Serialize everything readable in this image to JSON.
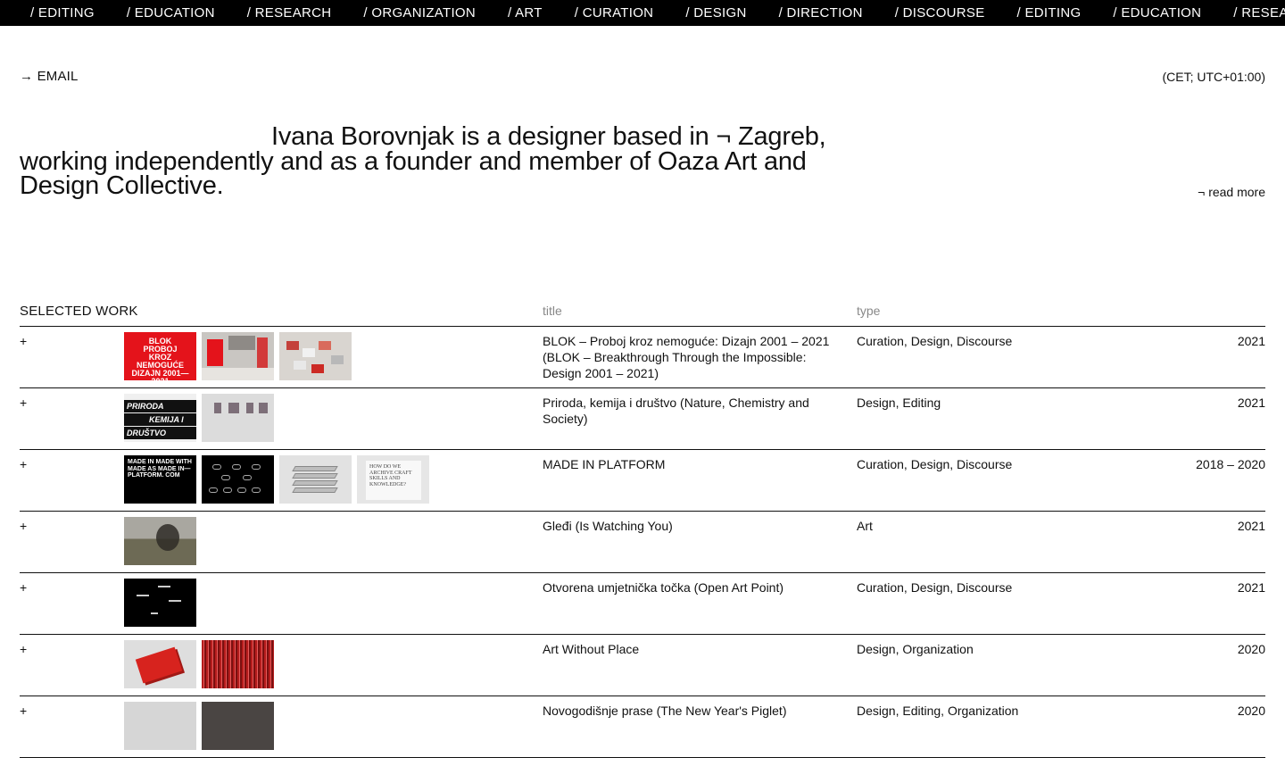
{
  "ticker": {
    "items": [
      "/ EDITING",
      "/ EDUCATION",
      "/ RESEARCH",
      "/ ORGANIZATION",
      "/ ART",
      "/ CURATION",
      "/ DESIGN",
      "/ DIRECTION",
      "/ DISCOURSE",
      "/ EDITING",
      "/ EDUCATION",
      "/ RESEARCH"
    ]
  },
  "header": {
    "email_link": "→ EMAIL",
    "timezone": "(CET; UTC+01:00)"
  },
  "intro": {
    "text": "Ivana Borovnjak is a designer based in ¬ Zagreb, working independently and as a founder and member of Oaza Art and Design Collective.",
    "read_more": "¬ read more"
  },
  "work": {
    "section_label": "SELECTED WORK",
    "col_title": "title",
    "col_type": "type",
    "rows": [
      {
        "plus": "+",
        "title": "BLOK – Proboj kroz nemoguće: Dizajn 2001 – 2021 (BLOK – Breakthrough Through the Impossible: Design 2001 – 2021)",
        "type": "Curation, Design, Discourse",
        "year": "2021",
        "thumb_text": "BLOK PROBOJ KROZ NEMOGUĆE DIZAJN 2001—2021"
      },
      {
        "plus": "+",
        "title": "Priroda, kemija i društvo (Nature, Chemistry and Society)",
        "type": "Design, Editing",
        "year": "2021",
        "thumb_text": [
          "PRIRODA",
          "KEMIJA I",
          "DRUŠTVO"
        ]
      },
      {
        "plus": "+",
        "title": "MADE IN PLATFORM",
        "type": "Curation, Design, Discourse",
        "year": "2018 – 2020",
        "thumb_text": "MADE IN MADE WITH MADE AS MADE IN— PLATFORM. COM",
        "paper_text": "HOW DO WE ARCHIVE CRAFT SKILLS AND KNOWLEDGE?"
      },
      {
        "plus": "+",
        "title": "Gleđi (Is Watching You)",
        "type": "Art",
        "year": "2021"
      },
      {
        "plus": "+",
        "title": "Otvorena umjetnička točka (Open Art Point)",
        "type": "Curation, Design, Discourse",
        "year": "2021"
      },
      {
        "plus": "+",
        "title": "Art Without Place",
        "type": "Design, Organization",
        "year": "2020"
      },
      {
        "plus": "+",
        "title": "Novogodišnje prase (The New Year's Piglet)",
        "type": "Design, Editing, Organization",
        "year": "2020"
      }
    ]
  }
}
